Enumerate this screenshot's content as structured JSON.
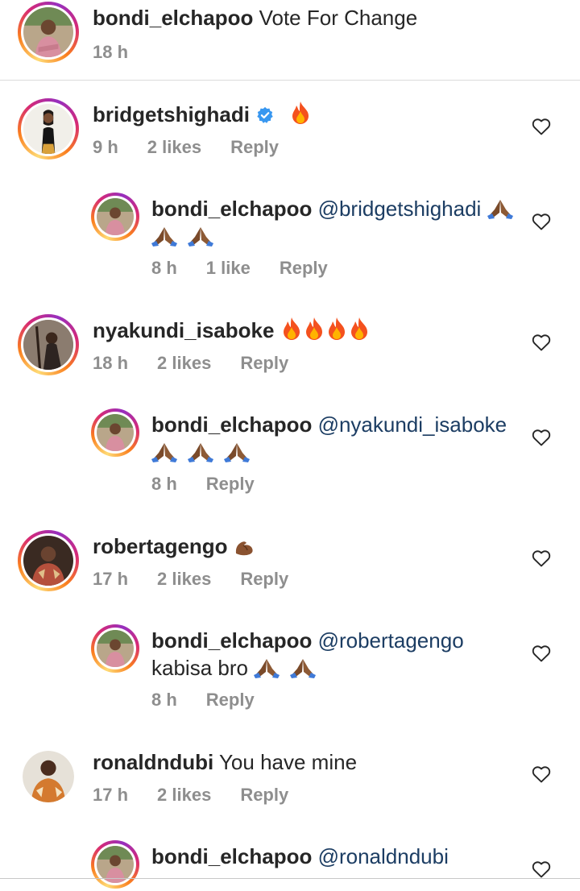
{
  "caption": {
    "username": "bondi_elchapoo",
    "text": "Vote For Change",
    "time": "18 h"
  },
  "comments": [
    {
      "username": "bridgetshighadi",
      "verified": true,
      "text": "",
      "emoji": "fire-emoji",
      "time": "9 h",
      "likes": "2 likes",
      "reply_label": "Reply",
      "reply": {
        "username": "bondi_elchapoo",
        "mention": "@bridgetshighadi",
        "text": "",
        "emoji": "folded-hands-emoji",
        "time": "8 h",
        "likes": "1 like",
        "reply_label": "Reply"
      }
    },
    {
      "username": "nyakundi_isaboke",
      "text": "",
      "emoji": "fire-emoji",
      "time": "18 h",
      "likes": "2 likes",
      "reply_label": "Reply",
      "reply": {
        "username": "bondi_elchapoo",
        "mention": "@nyakundi_isaboke",
        "text": "",
        "emoji": "folded-hands-emoji",
        "time": "8 h",
        "reply_label": "Reply"
      }
    },
    {
      "username": "robertagengo",
      "text": "",
      "emoji": "flexed-biceps-emoji",
      "time": "17 h",
      "likes": "2 likes",
      "reply_label": "Reply",
      "reply": {
        "username": "bondi_elchapoo",
        "mention": "@robertagengo",
        "text": "kabisa bro",
        "emoji": "folded-hands-emoji",
        "time": "8 h",
        "reply_label": "Reply"
      }
    },
    {
      "username": "ronaldndubi",
      "text": "You have mine",
      "time": "17 h",
      "likes": "2 likes",
      "reply_label": "Reply",
      "reply": {
        "username": "bondi_elchapoo",
        "mention": "@ronaldndubi"
      }
    }
  ],
  "colors": {
    "username": "#262626",
    "meta": "#8e8e8e",
    "mention": "#1c3d63",
    "verified": "#3897f0"
  },
  "icons": {
    "like": "heart-outline-icon"
  }
}
